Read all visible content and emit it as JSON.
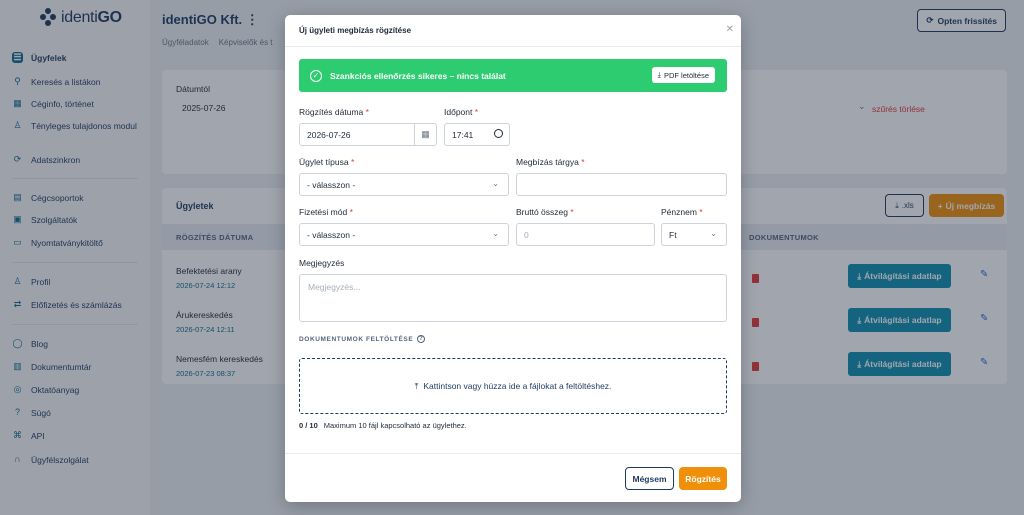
{
  "app": {
    "logo_text_light": "identi",
    "logo_text_bold": "GO"
  },
  "sidebar": {
    "items": [
      {
        "label": "Ügyfelek",
        "icon": "users-icon"
      },
      {
        "label": "Keresés a listákon",
        "icon": "search-icon"
      },
      {
        "label": "Céginfo, történet",
        "icon": "building-icon"
      },
      {
        "label": "Tényleges tulajdonos modul",
        "icon": "person-tree-icon"
      },
      {
        "label": "Adatszinkron",
        "icon": "sync-icon"
      },
      {
        "label": "Cégcsoportok",
        "icon": "group-icon"
      },
      {
        "label": "Szolgáltatók",
        "icon": "provider-icon"
      },
      {
        "label": "Nyomtatványkitöltő",
        "icon": "form-icon"
      },
      {
        "label": "Profil",
        "icon": "profile-icon"
      },
      {
        "label": "Előfizetés és számlázás",
        "icon": "billing-icon"
      },
      {
        "label": "Blog",
        "icon": "blog-icon"
      },
      {
        "label": "Dokumentumtár",
        "icon": "book-icon"
      },
      {
        "label": "Oktatóanyag",
        "icon": "tutorial-icon"
      },
      {
        "label": "Súgó",
        "icon": "help-icon"
      },
      {
        "label": "API",
        "icon": "api-icon"
      },
      {
        "label": "Ügyfélszolgálat",
        "icon": "headset-icon"
      }
    ]
  },
  "header": {
    "company": "identiGO Kft.",
    "tabs": [
      "Ügyféladatok",
      "Képviselők és t"
    ],
    "refresh_button": "Opten frissítés"
  },
  "filter": {
    "label": "Dátumtól",
    "value": "2025-07-26",
    "clear": "szűrés törlése"
  },
  "table": {
    "title": "Ügyletek",
    "xls_button": ".xls",
    "new_button": "Új megbízás",
    "columns": [
      "RÖGZÍTÉS DÁTUMA",
      "DOKUMENTUMOK"
    ],
    "rows": [
      {
        "name": "Befektetési arany",
        "date": "2026-07-24 12:12",
        "action": "Átvilágítási adatlap"
      },
      {
        "name": "Árukereskedés",
        "date": "2026-07-24 12:11",
        "action": "Átvilágítási adatlap"
      },
      {
        "name": "Nemesfém kereskedés",
        "date": "2026-07-23 08:37",
        "action": "Átvilágítási adatlap"
      }
    ]
  },
  "modal": {
    "title": "Új ügyleti megbízás rögzítése",
    "alert": {
      "text": "Szankciós ellenőrzés sikeres – nincs találat",
      "pdf_button": "PDF letöltése"
    },
    "fields": {
      "date_label": "Rögzítés dátuma",
      "date_value": "2026-07-26",
      "time_label": "Időpont",
      "time_value": "17:41",
      "type_label": "Ügylet típusa",
      "type_value": "- válasszon -",
      "subject_label": "Megbízás tárgya",
      "subject_value": "",
      "payment_label": "Fizetési mód",
      "payment_value": "- válasszon -",
      "amount_label": "Bruttó összeg",
      "amount_placeholder": "0",
      "currency_label": "Pénznem",
      "currency_value": "Ft",
      "note_label": "Megjegyzés",
      "note_placeholder": "Megjegyzés..."
    },
    "upload": {
      "title": "DOKUMENTUMOK FELTÖLTÉSE",
      "drop_text": "Kattintson vagy húzza ide a fájlokat a feltöltéshez.",
      "count": "0 / 10",
      "hint": "Maximum 10 fájl kapcsolható az ügylethez."
    },
    "buttons": {
      "cancel": "Mégsem",
      "save": "Rögzítés"
    }
  },
  "colors": {
    "primary": "#1e3a5f",
    "accent": "#f0900a",
    "success": "#2ecc71",
    "teal": "#0f8fb0",
    "danger": "#e53935"
  }
}
